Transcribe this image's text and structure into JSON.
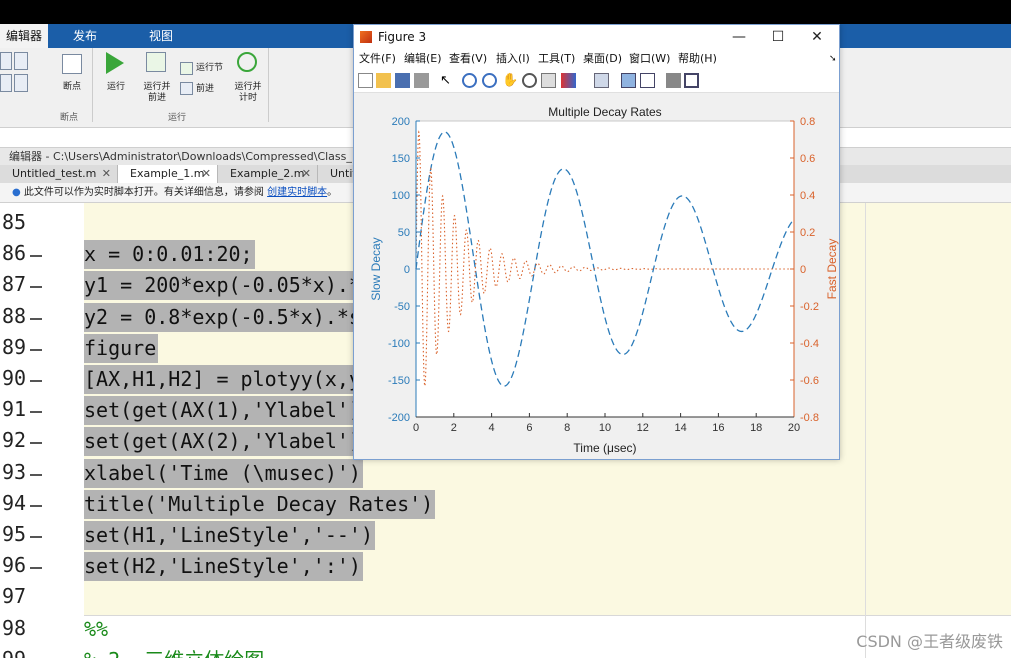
{
  "ribbon": {
    "tabs": [
      "编辑器",
      "发布",
      "视图"
    ],
    "buttons": {
      "breakpoints": "断点",
      "run": "运行",
      "run_advance_l1": "运行并",
      "run_advance_l2": "前进",
      "run_section": "运行节",
      "advance": "前进",
      "run_time_l1": "运行并",
      "run_time_l2": "计时"
    },
    "groups": [
      "断点",
      "运行"
    ]
  },
  "editor": {
    "title": "编辑器 - C:\\Users\\Administrator\\Downloads\\Compressed\\Class_1_Co",
    "file_tabs": [
      "Untitled_test.m",
      "Example_1.m",
      "Example_2.m",
      "Untitl"
    ],
    "info_text": "此文件可以作为实时脚本打开。有关详细信息，请参阅",
    "info_link": "创建实时脚本",
    "info_end": "。",
    "lines": [
      {
        "n": "85",
        "code": "",
        "sel": false
      },
      {
        "n": "86",
        "code": "x = 0:0.01:20;",
        "sel": true
      },
      {
        "n": "87",
        "code": "y1 = 200*exp(-0.05*x).*sin",
        "sel": true
      },
      {
        "n": "88",
        "code": "y2 = 0.8*exp(-0.5*x).*sin(",
        "sel": true
      },
      {
        "n": "89",
        "code": "figure",
        "sel": true
      },
      {
        "n": "90",
        "code": "[AX,H1,H2] = plotyy(x,y1,x",
        "sel": true
      },
      {
        "n": "91",
        "code": "set(get(AX(1),'Ylabel'),'S",
        "sel": true
      },
      {
        "n": "92",
        "code": "set(get(AX(2),'Ylabel'),'S",
        "sel": true
      },
      {
        "n": "93",
        "code": "xlabel('Time (\\musec)')",
        "sel": true
      },
      {
        "n": "94",
        "code": "title('Multiple Decay Rates')",
        "sel": true
      },
      {
        "n": "95",
        "code": "set(H1,'LineStyle','--')",
        "sel": true
      },
      {
        "n": "96",
        "code": "set(H2,'LineStyle',':')",
        "sel": true
      },
      {
        "n": "97",
        "code": "",
        "sel": false
      },
      {
        "n": "98",
        "code": "%%",
        "sel": false
      },
      {
        "n": "99",
        "code": "% 2  三维立体绘图",
        "sel": false
      }
    ]
  },
  "figure": {
    "title": "Figure 3",
    "menu": [
      "文件(F)",
      "编辑(E)",
      "查看(V)",
      "插入(I)",
      "工具(T)",
      "桌面(D)",
      "窗口(W)",
      "帮助(H)"
    ],
    "window_buttons": [
      "—",
      "☐",
      "✕"
    ],
    "colors": {
      "left": "#2b7bb9",
      "right": "#d9622b"
    }
  },
  "chart_data": {
    "type": "line",
    "title": "Multiple Decay Rates",
    "xlabel": "Time (μsec)",
    "ylabel": "Slow Decay",
    "ylabel_right": "Fast Decay",
    "xlim": [
      0,
      20
    ],
    "ylim": [
      -200,
      200
    ],
    "ylim_right": [
      -0.8,
      0.8
    ],
    "xticks": [
      "0",
      "2",
      "4",
      "6",
      "8",
      "10",
      "12",
      "14",
      "16",
      "18",
      "20"
    ],
    "yticks": [
      "-200",
      "-150",
      "-100",
      "-50",
      "0",
      "50",
      "100",
      "150",
      "200"
    ],
    "yticks_right": [
      "-0.8",
      "-0.6",
      "-0.4",
      "-0.2",
      "0",
      "0.2",
      "0.4",
      "0.6",
      "0.8"
    ],
    "series": [
      {
        "label": "y1 = 200*exp(-0.05*x).*sin(x)",
        "axis": "left",
        "style": "dashed",
        "color": "#2b7bb9",
        "x": [
          0,
          1.5,
          4.7,
          7.9,
          11.0,
          14.1,
          17.3,
          20
        ],
        "values": [
          0,
          185,
          -158,
          134,
          -115,
          99,
          -84,
          76
        ]
      },
      {
        "label": "y2 = 0.8*exp(-0.5*x).*sin(10*x)",
        "axis": "right",
        "style": "dotted",
        "color": "#d9622b",
        "x": [
          0,
          0.16,
          0.47,
          0.79,
          1.1,
          1.41,
          1.73,
          3.0,
          6.0
        ],
        "values": [
          0,
          0.74,
          -0.63,
          0.54,
          -0.46,
          0.39,
          -0.34,
          0.17,
          0.04
        ]
      }
    ]
  },
  "watermark": "CSDN @王者级废铁"
}
